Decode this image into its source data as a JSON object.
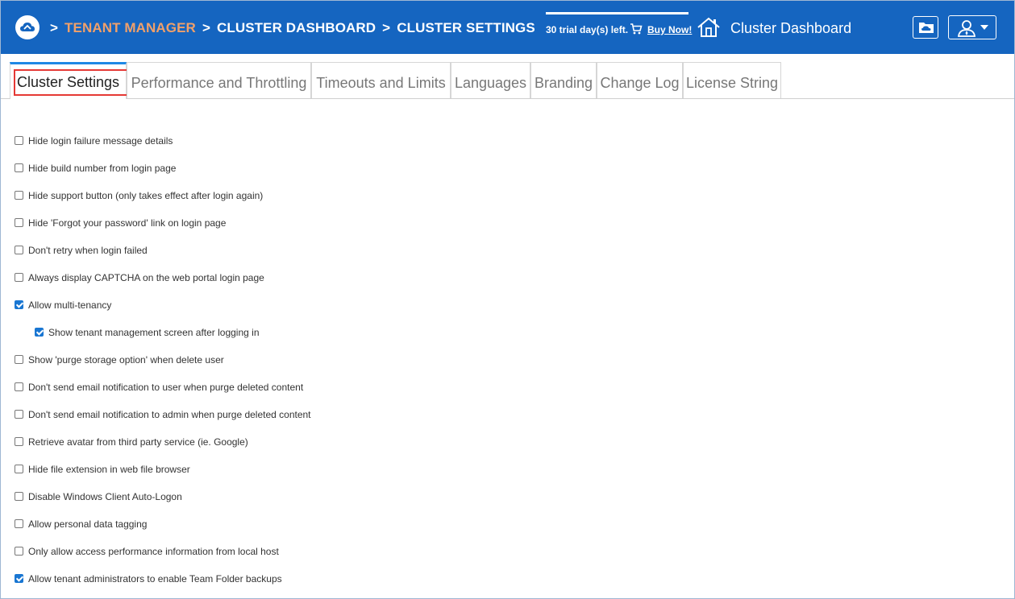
{
  "header": {
    "breadcrumb": {
      "separator": ">",
      "items": [
        "TENANT MANAGER",
        "CLUSTER DASHBOARD",
        "CLUSTER SETTINGS"
      ]
    },
    "trial_text": "30 trial day(s) left.",
    "buy_now": "Buy Now!",
    "title": "Cluster Dashboard",
    "icons": [
      "cloud-logo-icon",
      "cart-icon",
      "house-icon",
      "folder-cloud-icon",
      "user-icon",
      "caret-down-icon"
    ]
  },
  "tabs": [
    {
      "label": "Cluster Settings",
      "active": true
    },
    {
      "label": "Performance and Throttling",
      "active": false
    },
    {
      "label": "Timeouts and Limits",
      "active": false
    },
    {
      "label": "Languages",
      "active": false
    },
    {
      "label": "Branding",
      "active": false
    },
    {
      "label": "Change Log",
      "active": false
    },
    {
      "label": "License String",
      "active": false
    }
  ],
  "settings": [
    {
      "label": "Hide login failure message details",
      "checked": false
    },
    {
      "label": "Hide build number from login page",
      "checked": false
    },
    {
      "label": "Hide support button (only takes effect after login again)",
      "checked": false
    },
    {
      "label": "Hide 'Forgot your password' link on login page",
      "checked": false
    },
    {
      "label": "Don't retry when login failed",
      "checked": false
    },
    {
      "label": "Always display CAPTCHA on the web portal login page",
      "checked": false
    },
    {
      "label": "Allow multi-tenancy",
      "checked": true
    },
    {
      "label": "Show tenant management screen after logging in",
      "checked": true,
      "indent": true
    },
    {
      "label": "Show 'purge storage option' when delete user",
      "checked": false
    },
    {
      "label": "Don't send email notification to user when purge deleted content",
      "checked": false
    },
    {
      "label": "Don't send email notification to admin when purge deleted content",
      "checked": false
    },
    {
      "label": "Retrieve avatar from third party service (ie. Google)",
      "checked": false
    },
    {
      "label": "Hide file extension in web file browser",
      "checked": false
    },
    {
      "label": "Disable Windows Client Auto-Logon",
      "checked": false
    },
    {
      "label": "Allow personal data tagging",
      "checked": false
    },
    {
      "label": "Only allow access performance information from local host",
      "checked": false
    },
    {
      "label": "Allow tenant administrators to enable Team Folder backups",
      "checked": true
    }
  ],
  "colors": {
    "header_bg": "#1565c0",
    "breadcrumb_active": "#f0a06a",
    "tab_accent": "#1e88e5",
    "highlight_box": "#e53935",
    "checkbox_checked": "#1976d2"
  }
}
